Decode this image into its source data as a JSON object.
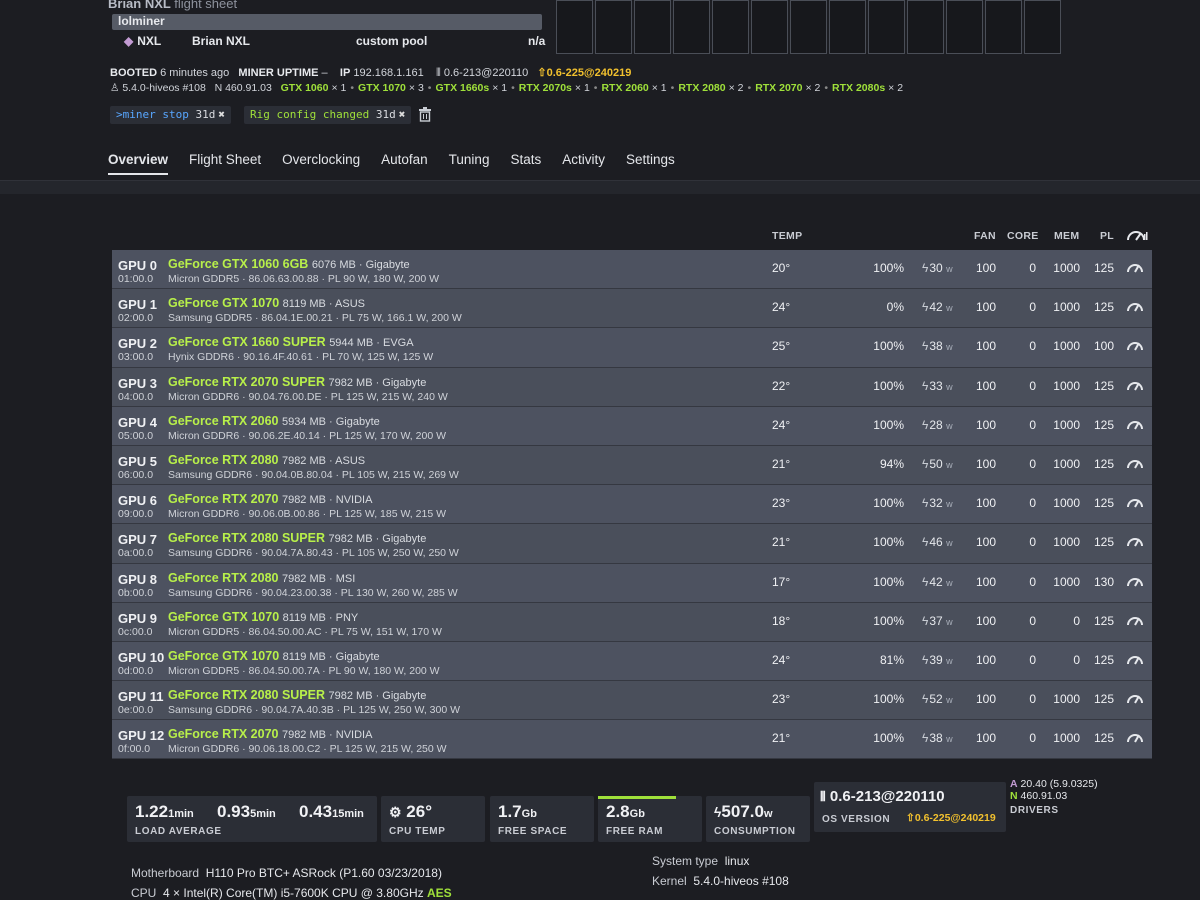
{
  "header": {
    "flight_sheet_owner": "Brian NXL",
    "flight_sheet_suffix": "flight sheet",
    "miner": "lolminer",
    "coin": "NXL",
    "wallet": "Brian NXL",
    "pool": "custom pool",
    "hash": "n/a"
  },
  "info": {
    "booted_label": "BOOTED",
    "booted_value": "6 minutes ago",
    "uptime_label": "MINER UPTIME",
    "uptime_value": "–",
    "ip_label": "IP",
    "ip_value": "192.168.1.161",
    "os_version": "0.6-213@220110",
    "os_update": "0.6-225@240219",
    "kernel": "5.4.0-hiveos #108",
    "nvidia_driver": "N 460.91.03",
    "gpu_counts": [
      {
        "model": "GTX 1060",
        "count": "× 1"
      },
      {
        "model": "GTX 1070",
        "count": "× 3"
      },
      {
        "model": "GTX 1660s",
        "count": "× 1"
      },
      {
        "model": "RTX 2070s",
        "count": "× 1"
      },
      {
        "model": "RTX 2060",
        "count": "× 1"
      },
      {
        "model": "RTX 2080",
        "count": "× 2"
      },
      {
        "model": "RTX 2070",
        "count": "× 2"
      },
      {
        "model": "RTX 2080s",
        "count": "× 2"
      }
    ]
  },
  "chips": {
    "chip1_prompt": ">",
    "chip1_cmd": "miner stop",
    "chip1_time": "31d",
    "chip2_cmd": "Rig config changed",
    "chip2_time": "31d",
    "close": "✖"
  },
  "tabs": [
    "Overview",
    "Flight Sheet",
    "Overclocking",
    "Autofan",
    "Tuning",
    "Stats",
    "Activity",
    "Settings"
  ],
  "columns": {
    "temp": "TEMP",
    "fan": "FAN",
    "core": "CORE",
    "mem": "MEM",
    "pl": "PL"
  },
  "gpus": [
    {
      "id": "GPU 0",
      "bus": "01:00.0",
      "name": "GeForce GTX 1060 6GB",
      "vram": "6076 MB · Gigabyte",
      "mem": "Micron GDDR5 · 86.06.63.00.88 · PL 90 W, 180 W, 200 W",
      "temp": "20°",
      "fanp": "100%",
      "power": "30",
      "fan": "100",
      "core": "0",
      "memc": "1000",
      "pl": "125"
    },
    {
      "id": "GPU 1",
      "bus": "02:00.0",
      "name": "GeForce GTX 1070",
      "vram": "8119 MB · ASUS",
      "mem": "Samsung GDDR5 · 86.04.1E.00.21 · PL 75 W, 166.1 W, 200 W",
      "temp": "24°",
      "fanp": "0%",
      "power": "42",
      "fan": "100",
      "core": "0",
      "memc": "1000",
      "pl": "125"
    },
    {
      "id": "GPU 2",
      "bus": "03:00.0",
      "name": "GeForce GTX 1660 SUPER",
      "vram": "5944 MB · EVGA",
      "mem": "Hynix GDDR6 · 90.16.4F.40.61 · PL 70 W, 125 W, 125 W",
      "temp": "25°",
      "fanp": "100%",
      "power": "38",
      "fan": "100",
      "core": "0",
      "memc": "1000",
      "pl": "100"
    },
    {
      "id": "GPU 3",
      "bus": "04:00.0",
      "name": "GeForce RTX 2070 SUPER",
      "vram": "7982 MB · Gigabyte",
      "mem": "Micron GDDR6 · 90.04.76.00.DE · PL 125 W, 215 W, 240 W",
      "temp": "22°",
      "fanp": "100%",
      "power": "33",
      "fan": "100",
      "core": "0",
      "memc": "1000",
      "pl": "125"
    },
    {
      "id": "GPU 4",
      "bus": "05:00.0",
      "name": "GeForce RTX 2060",
      "vram": "5934 MB · Gigabyte",
      "mem": "Micron GDDR6 · 90.06.2E.40.14 · PL 125 W, 170 W, 200 W",
      "temp": "24°",
      "fanp": "100%",
      "power": "28",
      "fan": "100",
      "core": "0",
      "memc": "1000",
      "pl": "125"
    },
    {
      "id": "GPU 5",
      "bus": "06:00.0",
      "name": "GeForce RTX 2080",
      "vram": "7982 MB · ASUS",
      "mem": "Samsung GDDR6 · 90.04.0B.80.04 · PL 105 W, 215 W, 269 W",
      "temp": "21°",
      "fanp": "94%",
      "power": "50",
      "fan": "100",
      "core": "0",
      "memc": "1000",
      "pl": "125"
    },
    {
      "id": "GPU 6",
      "bus": "09:00.0",
      "name": "GeForce RTX 2070",
      "vram": "7982 MB · NVIDIA",
      "mem": "Micron GDDR6 · 90.06.0B.00.86 · PL 125 W, 185 W, 215 W",
      "temp": "23°",
      "fanp": "100%",
      "power": "32",
      "fan": "100",
      "core": "0",
      "memc": "1000",
      "pl": "125"
    },
    {
      "id": "GPU 7",
      "bus": "0a:00.0",
      "name": "GeForce RTX 2080 SUPER",
      "vram": "7982 MB · Gigabyte",
      "mem": "Samsung GDDR6 · 90.04.7A.80.43 · PL 105 W, 250 W, 250 W",
      "temp": "21°",
      "fanp": "100%",
      "power": "46",
      "fan": "100",
      "core": "0",
      "memc": "1000",
      "pl": "125"
    },
    {
      "id": "GPU 8",
      "bus": "0b:00.0",
      "name": "GeForce RTX 2080",
      "vram": "7982 MB · MSI",
      "mem": "Samsung GDDR6 · 90.04.23.00.38 · PL 130 W, 260 W, 285 W",
      "temp": "17°",
      "fanp": "100%",
      "power": "42",
      "fan": "100",
      "core": "0",
      "memc": "1000",
      "pl": "130"
    },
    {
      "id": "GPU 9",
      "bus": "0c:00.0",
      "name": "GeForce GTX 1070",
      "vram": "8119 MB · PNY",
      "mem": "Micron GDDR5 · 86.04.50.00.AC · PL 75 W, 151 W, 170 W",
      "temp": "18°",
      "fanp": "100%",
      "power": "37",
      "fan": "100",
      "core": "0",
      "memc": "0",
      "pl": "125"
    },
    {
      "id": "GPU 10",
      "bus": "0d:00.0",
      "name": "GeForce GTX 1070",
      "vram": "8119 MB · Gigabyte",
      "mem": "Micron GDDR5 · 86.04.50.00.7A · PL 90 W, 180 W, 200 W",
      "temp": "24°",
      "fanp": "81%",
      "power": "39",
      "fan": "100",
      "core": "0",
      "memc": "0",
      "pl": "125"
    },
    {
      "id": "GPU 11",
      "bus": "0e:00.0",
      "name": "GeForce RTX 2080 SUPER",
      "vram": "7982 MB · Gigabyte",
      "mem": "Samsung GDDR6 · 90.04.7A.40.3B · PL 125 W, 250 W, 300 W",
      "temp": "23°",
      "fanp": "100%",
      "power": "52",
      "fan": "100",
      "core": "0",
      "memc": "1000",
      "pl": "125"
    },
    {
      "id": "GPU 12",
      "bus": "0f:00.0",
      "name": "GeForce RTX 2070",
      "vram": "7982 MB · NVIDIA",
      "mem": "Micron GDDR6 · 90.06.18.00.C2 · PL 125 W, 215 W, 250 W",
      "temp": "21°",
      "fanp": "100%",
      "power": "38",
      "fan": "100",
      "core": "0",
      "memc": "1000",
      "pl": "125"
    }
  ],
  "stats": {
    "la1": "1.22",
    "la1_u": "1min",
    "la5": "0.93",
    "la5_u": "5min",
    "la15": "0.43",
    "la15_u": "15min",
    "la_label": "LOAD AVERAGE",
    "cpu_temp": "26°",
    "cpu_temp_label": "CPU TEMP",
    "free_space": "1.7",
    "free_space_u": "Gb",
    "free_space_label": "FREE SPACE",
    "free_ram": "2.8",
    "free_ram_u": "Gb",
    "free_ram_label": "FREE RAM",
    "free_ram_fraction": 0.75,
    "consumption": "507.0",
    "consumption_u": "w",
    "consumption_label": "CONSUMPTION",
    "os_version": "0.6-213@220110",
    "os_update": "0.6-225@240219",
    "os_label": "OS VERSION",
    "drv_a": "A",
    "drv_a_val": "20.40 (5.9.0325)",
    "drv_n": "N",
    "drv_n_val": "460.91.03",
    "drivers_label": "DRIVERS"
  },
  "system": {
    "motherboard_label": "Motherboard",
    "motherboard": "H110 Pro BTC+ ASRock (P1.60 03/23/2018)",
    "cpu_label": "CPU",
    "cpu": "4 × Intel(R) Core(TM) i5-7600K CPU @ 3.80GHz",
    "cpu_flag": "AES",
    "system_type_label": "System type",
    "system_type": "linux",
    "kernel_label": "Kernel",
    "kernel": "5.4.0-hiveos #108"
  },
  "colors": {
    "accent_green": "#9fe03a",
    "gpu_name": "#b8f04a",
    "update_yellow": "#f2c12e",
    "amd_purple": "#c39bd3"
  }
}
